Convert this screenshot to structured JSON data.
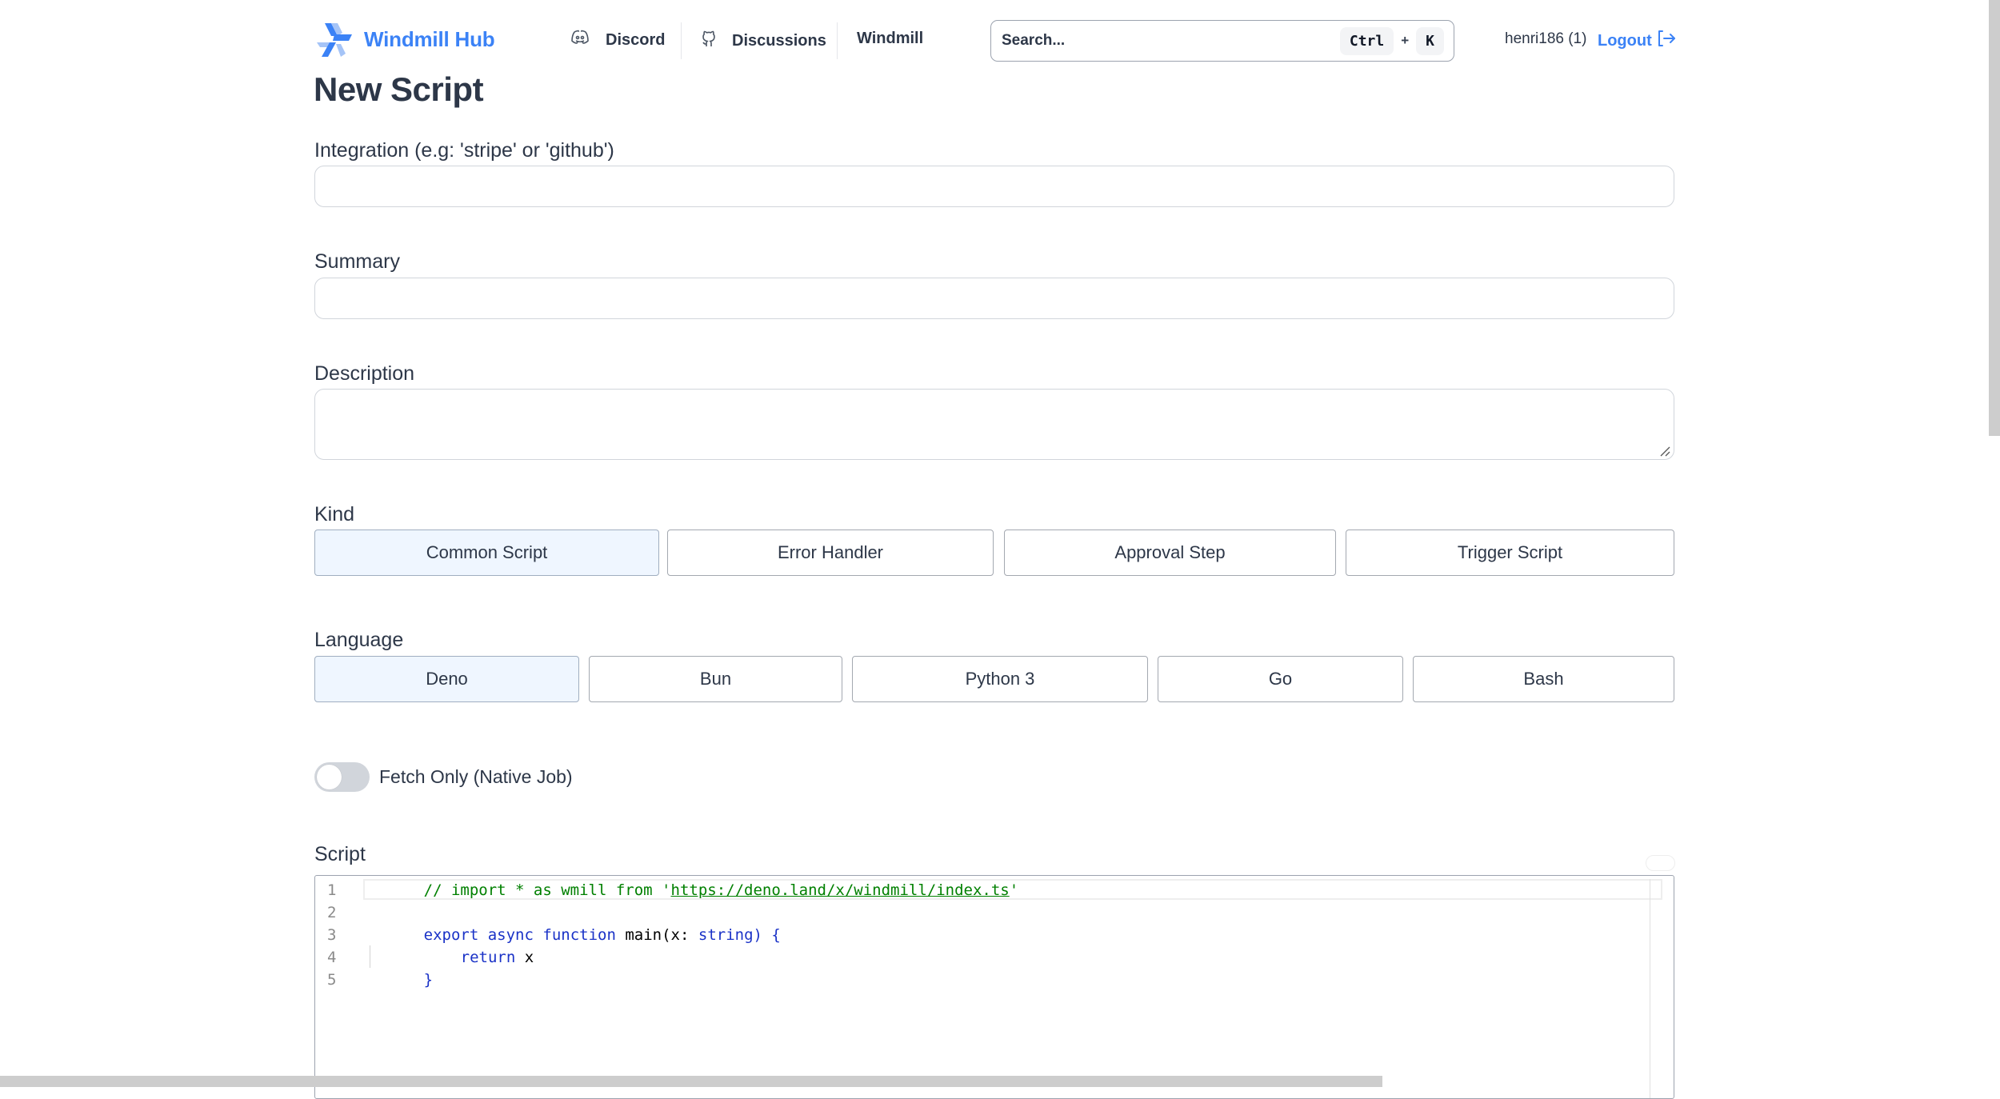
{
  "header": {
    "brand": "Windmill Hub",
    "logo_icon": "windmill-logo-icon",
    "nav": [
      {
        "label": "Discord",
        "icon": "discord-icon"
      },
      {
        "label": "Discussions",
        "icon": "github-icon"
      },
      {
        "label": "Windmill",
        "icon": null
      }
    ],
    "search": {
      "placeholder": "Search...",
      "shortcut_keys": [
        "Ctrl",
        "K"
      ],
      "shortcut_joiner": "+"
    },
    "user": "henri186 (1)",
    "logout_label": "Logout",
    "logout_icon": "logout-arrow-icon"
  },
  "page": {
    "title": "New Script"
  },
  "form": {
    "integration": {
      "label": "Integration (e.g: 'stripe' or 'github')",
      "value": "",
      "placeholder": ""
    },
    "summary": {
      "label": "Summary",
      "value": "",
      "placeholder": ""
    },
    "description": {
      "label": "Description",
      "value": "",
      "placeholder": ""
    },
    "kind": {
      "label": "Kind",
      "selected": "Common Script",
      "options": [
        "Common Script",
        "Error Handler",
        "Approval Step",
        "Trigger Script"
      ]
    },
    "language": {
      "label": "Language",
      "selected": "Deno",
      "options": [
        "Deno",
        "Bun",
        "Python 3",
        "Go",
        "Bash"
      ]
    },
    "fetch_only": {
      "label": "Fetch Only (Native Job)",
      "enabled": false
    },
    "script": {
      "label": "Script",
      "line_numbers": [
        "1",
        "2",
        "3",
        "4",
        "5"
      ],
      "lines": [
        "// import * as wmill from 'https://deno.land/x/windmill/index.ts'",
        "",
        "export async function main(x: string) {",
        "    return x",
        "}"
      ],
      "tokens": {
        "l1_comment_pre": "// import * as wmill from '",
        "l1_link": "https://deno.land/x/windmill/index.ts",
        "l1_comment_post": "'",
        "l3_export": "export",
        "l3_async": "async",
        "l3_function": "function",
        "l3_main": "main(x: ",
        "l3_string": "string",
        "l3_close": ") {",
        "l4_return": "return",
        "l4_x": " x",
        "l5_brace": "}"
      }
    }
  },
  "colors": {
    "accent": "#3b82f6",
    "selected_bg": "#eff6ff",
    "text": "#2d3748",
    "toggle_off": "#d1d5db",
    "code_comment": "#008000",
    "code_keyword": "#1a32c7"
  }
}
